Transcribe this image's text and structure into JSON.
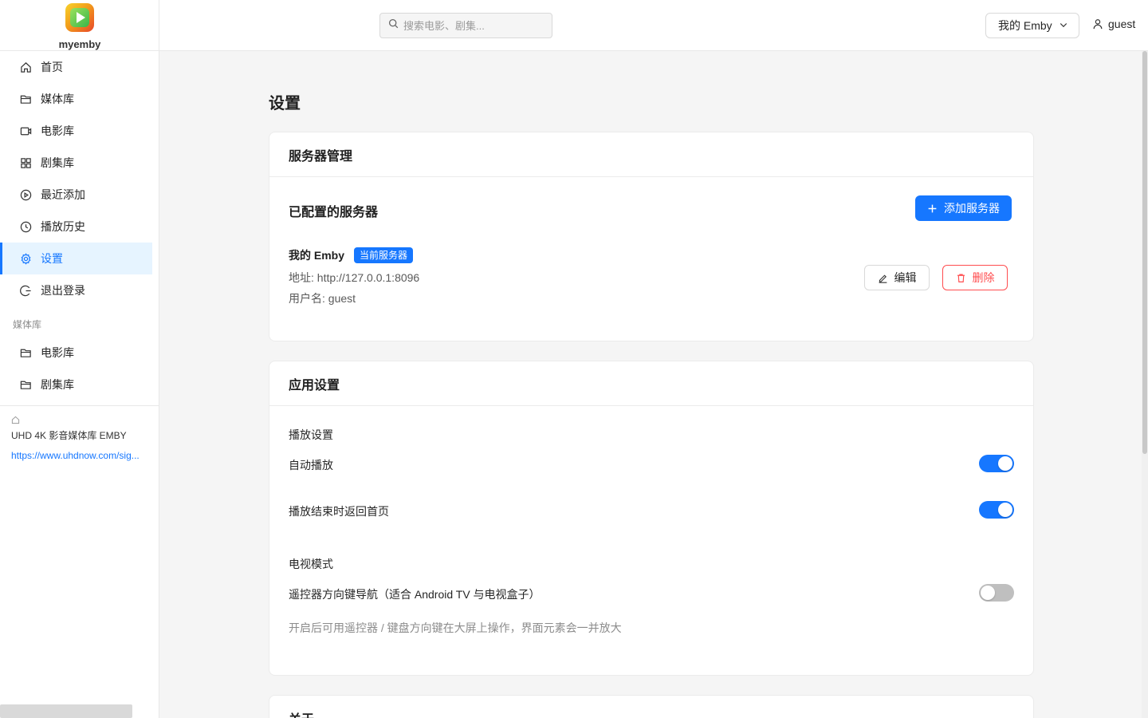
{
  "app": {
    "name": "myemby"
  },
  "sidebar": {
    "menu": [
      {
        "label": "首页",
        "icon": "home-icon"
      },
      {
        "label": "媒体库",
        "icon": "folder-icon"
      },
      {
        "label": "电影库",
        "icon": "video-camera-icon"
      },
      {
        "label": "剧集库",
        "icon": "grid-icon"
      },
      {
        "label": "最近添加",
        "icon": "play-circle-icon"
      },
      {
        "label": "播放历史",
        "icon": "history-icon"
      },
      {
        "label": "设置",
        "icon": "gear-icon",
        "active": true
      },
      {
        "label": "退出登录",
        "icon": "logout-icon"
      }
    ],
    "group_title": "媒体库",
    "libraries": [
      {
        "label": "电影库",
        "icon": "folder-icon"
      },
      {
        "label": "剧集库",
        "icon": "folder-icon"
      }
    ],
    "ad": {
      "title": "UHD 4K 影音媒体库 EMBY",
      "link": "https://www.uhdnow.com/sig..."
    }
  },
  "header": {
    "search_placeholder": "搜索电影、剧集...",
    "server_select": "我的 Emby",
    "username": "guest"
  },
  "page": {
    "title": "设置"
  },
  "server_card": {
    "title": "服务器管理",
    "configured_title": "已配置的服务器",
    "add_button": "添加服务器",
    "server": {
      "name": "我的 Emby",
      "tag": "当前服务器",
      "address": "地址: http://127.0.0.1:8096",
      "username": "用户名: guest",
      "edit_button": "编辑",
      "delete_button": "删除"
    }
  },
  "app_card": {
    "title": "应用设置",
    "playback_section": "播放设置",
    "autoplay_label": "自动播放",
    "autoplay_on": true,
    "return_home_label": "播放结束时返回首页",
    "return_home_on": true,
    "tv_section": "电视模式",
    "remote_nav_label": "遥控器方向键导航（适合 Android TV 与电视盒子）",
    "remote_nav_on": false,
    "remote_nav_hint": "开启后可用遥控器 / 键盘方向键在大屏上操作，界面元素会一并放大"
  },
  "about_card": {
    "title": "关于"
  },
  "colors": {
    "accent": "#1677ff",
    "danger": "#ff4d4f",
    "active_bg": "#e6f4ff"
  }
}
